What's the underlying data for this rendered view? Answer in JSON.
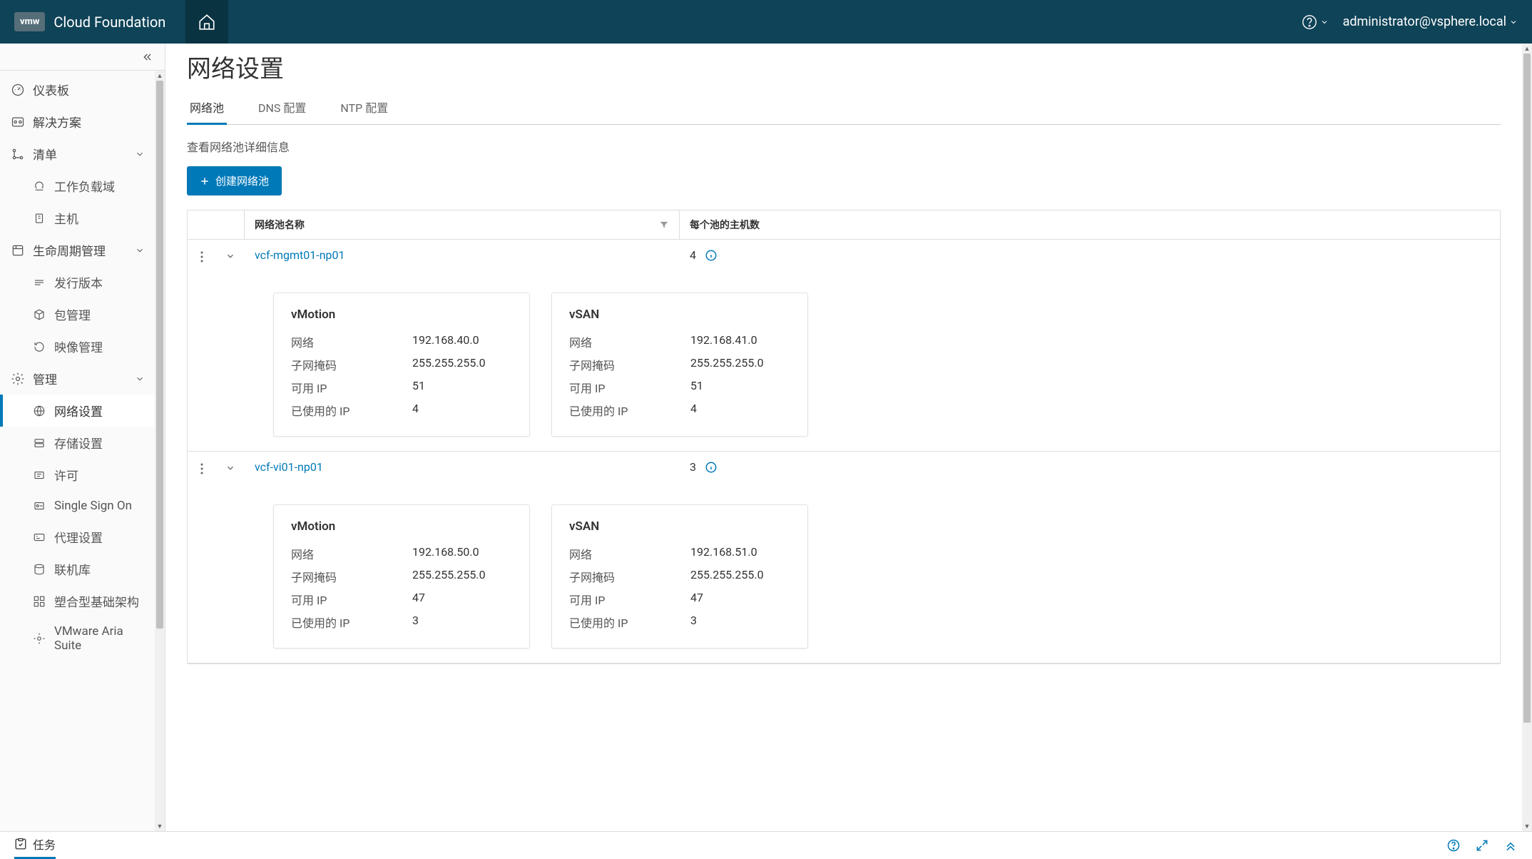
{
  "header": {
    "logo": "vmw",
    "product": "Cloud Foundation",
    "user": "administrator@vsphere.local"
  },
  "sidebar": {
    "items": [
      {
        "label": "仪表板"
      },
      {
        "label": "解决方案"
      },
      {
        "label": "清单"
      },
      {
        "label": "工作负载域"
      },
      {
        "label": "主机"
      },
      {
        "label": "生命周期管理"
      },
      {
        "label": "发行版本"
      },
      {
        "label": "包管理"
      },
      {
        "label": "映像管理"
      },
      {
        "label": "管理"
      },
      {
        "label": "网络设置"
      },
      {
        "label": "存储设置"
      },
      {
        "label": "许可"
      },
      {
        "label": "Single Sign On"
      },
      {
        "label": "代理设置"
      },
      {
        "label": "联机库"
      },
      {
        "label": "塑合型基础架构"
      },
      {
        "label": "VMware Aria Suite"
      }
    ]
  },
  "page": {
    "title": "网络设置",
    "tabs": [
      "网络池",
      "DNS 配置",
      "NTP 配置"
    ],
    "subtitle": "查看网络池详细信息",
    "create_btn": "创建网络池",
    "columns": {
      "name": "网络池名称",
      "hosts": "每个池的主机数"
    },
    "card_labels": {
      "network": "网络",
      "subnet": "子网掩码",
      "available": "可用 IP",
      "used": "已使用的 IP"
    },
    "pools": [
      {
        "name": "vcf-mgmt01-np01",
        "hosts": "4",
        "cards": [
          {
            "title": "vMotion",
            "network": "192.168.40.0",
            "subnet": "255.255.255.0",
            "available": "51",
            "used": "4"
          },
          {
            "title": "vSAN",
            "network": "192.168.41.0",
            "subnet": "255.255.255.0",
            "available": "51",
            "used": "4"
          }
        ]
      },
      {
        "name": "vcf-vi01-np01",
        "hosts": "3",
        "cards": [
          {
            "title": "vMotion",
            "network": "192.168.50.0",
            "subnet": "255.255.255.0",
            "available": "47",
            "used": "3"
          },
          {
            "title": "vSAN",
            "network": "192.168.51.0",
            "subnet": "255.255.255.0",
            "available": "47",
            "used": "3"
          }
        ]
      }
    ]
  },
  "footer": {
    "tasks": "任务"
  }
}
